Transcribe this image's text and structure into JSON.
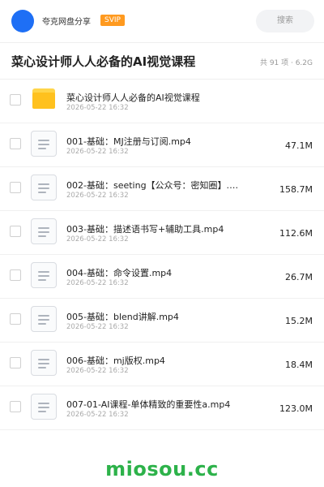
{
  "header": {
    "brand": "夸克网盘分享",
    "badge": "SVIP",
    "search_label": "搜索"
  },
  "folder": {
    "title": "菜心设计师人人必备的AI视觉课程",
    "summary": "共 91 项 · 6.2G"
  },
  "items": [
    {
      "type": "folder",
      "name": "菜心设计师人人必备的AI视觉课程",
      "date": "2026-05-22 16:32",
      "size": ""
    },
    {
      "type": "file",
      "name": "001-基础：MJ注册与订阅.mp4",
      "date": "2026-05-22 16:32",
      "size": "47.1M"
    },
    {
      "type": "file",
      "name": "002-基础：seeting【公众号：密知圈】.m…",
      "date": "2026-05-22 16:32",
      "size": "158.7M"
    },
    {
      "type": "file",
      "name": "003-基础：描述语书写+辅助工具.mp4",
      "date": "2026-05-22 16:32",
      "size": "112.6M"
    },
    {
      "type": "file",
      "name": "004-基础：命令设置.mp4",
      "date": "2026-05-22 16:32",
      "size": "26.7M"
    },
    {
      "type": "file",
      "name": "005-基础：blend讲解.mp4",
      "date": "2026-05-22 16:32",
      "size": "15.2M"
    },
    {
      "type": "file",
      "name": "006-基础：mj版权.mp4",
      "date": "2026-05-22 16:32",
      "size": "18.4M"
    },
    {
      "type": "file",
      "name": "007-01-AI课程-单体精致的重要性a.mp4",
      "date": "2026-05-22 16:32",
      "size": "123.0M"
    }
  ],
  "watermark": "miosou.cc",
  "colors": {
    "accent": "#1e6ff5",
    "badge": "#ff9a1f",
    "folder": "#ffc11e",
    "watermark": "#2db24a"
  }
}
